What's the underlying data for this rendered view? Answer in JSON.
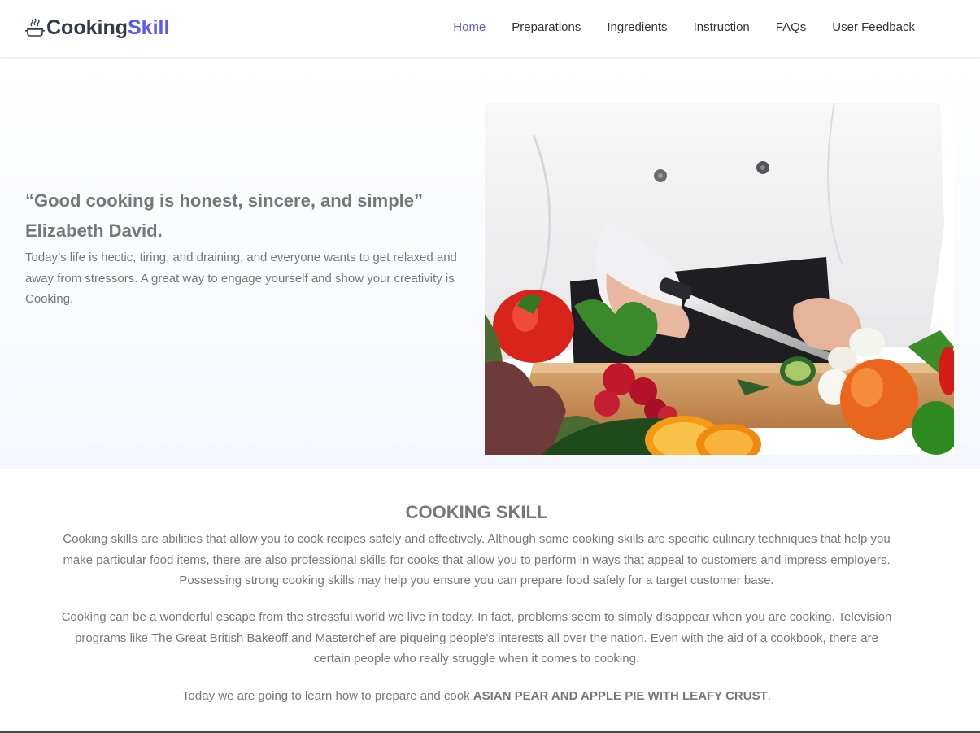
{
  "brand": {
    "name_part1": "Cooking",
    "name_part2": "Skill",
    "icon": "cooking-pot-icon",
    "accent_color": "#5b5be8",
    "dark_color": "#333a4d"
  },
  "nav": {
    "items": [
      {
        "label": "Home",
        "active": true
      },
      {
        "label": "Preparations",
        "active": false
      },
      {
        "label": "Ingredients",
        "active": false
      },
      {
        "label": "Instruction",
        "active": false
      },
      {
        "label": "FAQs",
        "active": false
      },
      {
        "label": "User Feedback",
        "active": false
      }
    ]
  },
  "hero": {
    "quote": "“Good cooking is honest, sincere, and simple” Elizabeth David.",
    "description": "Today’s life is hectic, tiring, and draining, and everyone wants to get relaxed and away from stressors. A great way to engage yourself and show your creativity is Cooking.",
    "image": "chef-cutting-vegetables-photo"
  },
  "section": {
    "title": "COOKING SKILL",
    "paragraph1": "Cooking skills are abilities that allow you to cook recipes safely and effectively. Although some cooking skills are specific culinary techniques that help you make particular food items, there are also professional skills for cooks that allow you to perform in ways that appeal to customers and impress employers. Possessing strong cooking skills may help you ensure you can prepare food safely for a target customer base.",
    "paragraph2": "Cooking can be a wonderful escape from the stressful world we live in today. In fact, problems seem to simply disappear when you are cooking. Television programs like The Great British Bakeoff and Masterchef are piqueing people's interests all over the nation. Even with the aid of a cookbook, there are certain people who really struggle when it comes to cooking.",
    "paragraph3_prefix": "Today we are going to learn how to prepare and cook ",
    "paragraph3_bold": "ASIAN PEAR AND APPLE PIE WITH LEAFY CRUST",
    "paragraph3_suffix": "."
  }
}
